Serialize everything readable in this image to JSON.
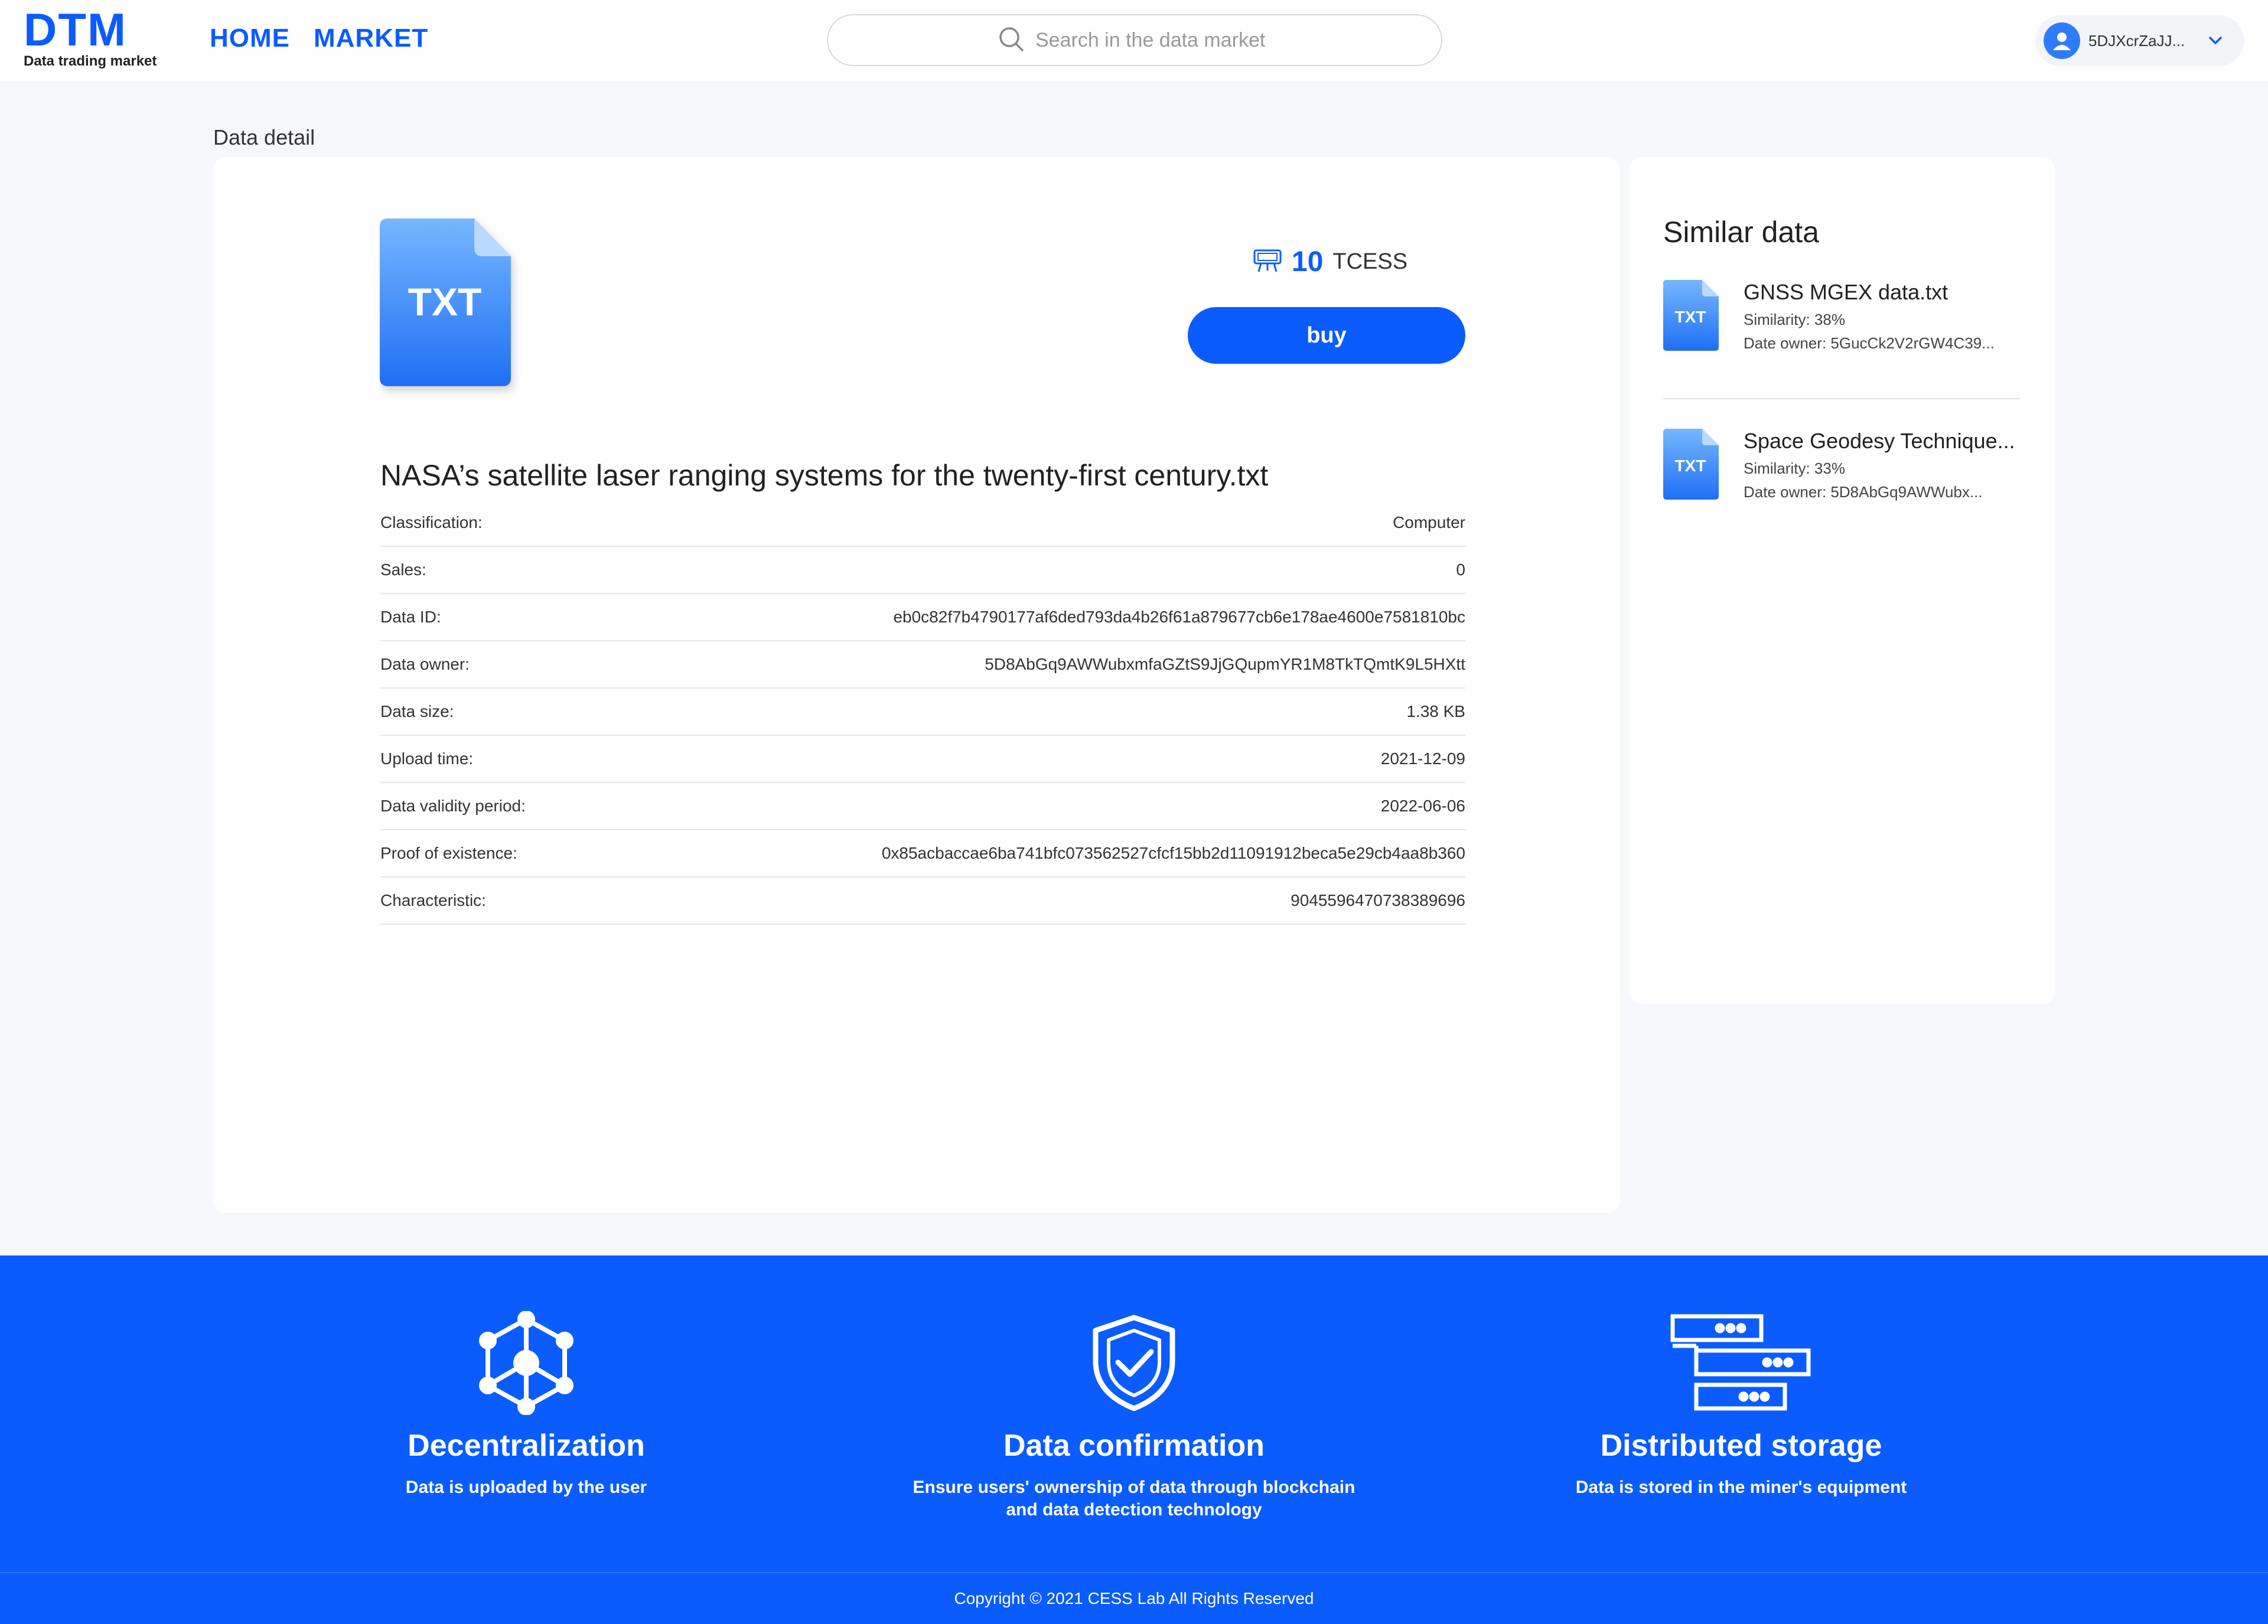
{
  "header": {
    "logo": "DTM",
    "logo_subtitle": "Data trading market",
    "nav": [
      "HOME",
      "MARKET"
    ],
    "search_placeholder": "Search in the data market",
    "user_name": "5DJXcrZaJJ...",
    "icons": [
      "search-icon",
      "user-avatar-icon",
      "chevron-down-icon"
    ]
  },
  "page_title": "Data detail",
  "detail": {
    "file_type": "TXT",
    "price_value": "10",
    "price_unit": "TCESS",
    "buy_label": "buy",
    "file_name": "NASA’s satellite laser ranging systems for the twenty-first century.txt",
    "rows": [
      {
        "label": "Classification:",
        "value": "Computer"
      },
      {
        "label": "Sales:",
        "value": "0"
      },
      {
        "label": "Data ID:",
        "value": "eb0c82f7b4790177af6ded793da4b26f61a879677cb6e178ae4600e7581810bc"
      },
      {
        "label": "Data owner:",
        "value": "5D8AbGq9AWWubxmfaGZtS9JjGQupmYR1M8TkTQmtK9L5HXtt"
      },
      {
        "label": "Data size:",
        "value": "1.38 KB"
      },
      {
        "label": "Upload time:",
        "value": "2021-12-09"
      },
      {
        "label": "Data validity period:",
        "value": "2022-06-06"
      },
      {
        "label": "Proof of existence:",
        "value": "0x85acbaccae6ba741bfc073562527cfcf15bb2d11091912beca5e29cb4aa8b360"
      },
      {
        "label": "Characteristic:",
        "value": "9045596470738389696"
      }
    ]
  },
  "similar": {
    "title": "Similar data",
    "items": [
      {
        "file_type": "TXT",
        "name": "GNSS MGEX data.txt",
        "similarity": "Similarity: 38%",
        "owner": "Date owner: 5GucCk2V2rGW4C39..."
      },
      {
        "file_type": "TXT",
        "name": "Space Geodesy Technique...",
        "similarity": "Similarity: 33%",
        "owner": "Date owner: 5D8AbGq9AWWubx..."
      }
    ]
  },
  "features": [
    {
      "icon": "cube-network-icon",
      "title": "Decentralization",
      "desc": "Data is uploaded by the user"
    },
    {
      "icon": "shield-check-icon",
      "title": "Data confirmation",
      "desc": "Ensure users' ownership of data through blockchain and data detection technology"
    },
    {
      "icon": "server-stack-icon",
      "title": "Distributed storage",
      "desc": "Data is stored in the miner's equipment"
    }
  ],
  "footer": {
    "copyright": "Copyright © 2021 CESS Lab All Rights Reserved"
  },
  "colors": {
    "brand": "#0b5cff",
    "band": "#0a5cff",
    "page_bg": "#f7f8fb"
  }
}
